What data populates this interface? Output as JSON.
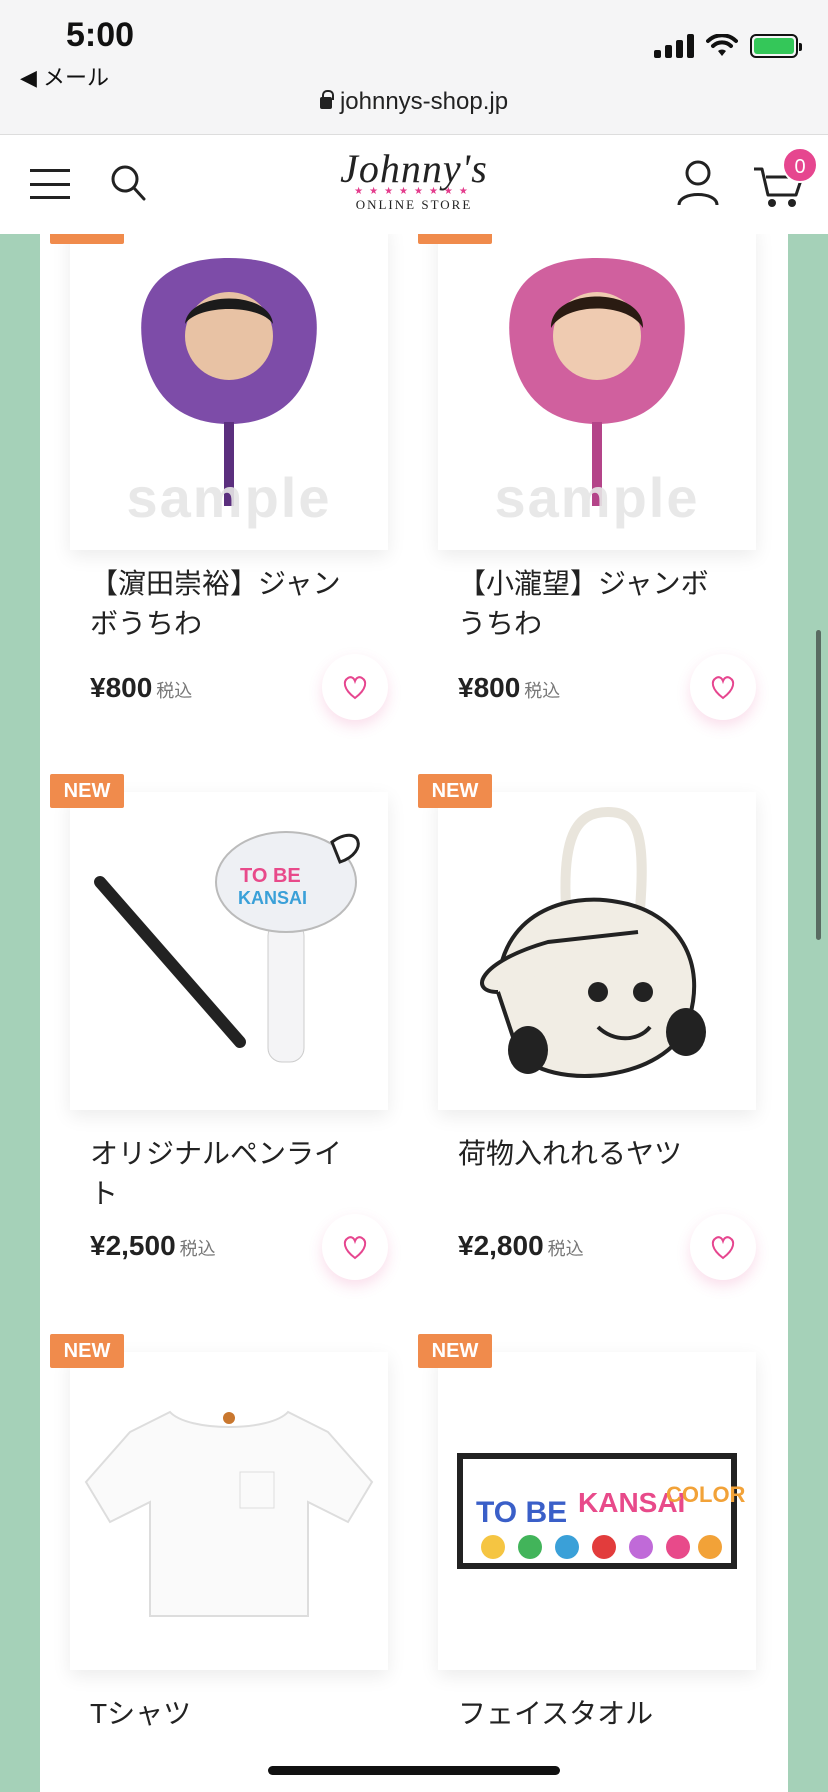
{
  "status_bar": {
    "time": "5:00",
    "back_label": "◀ メール",
    "url": "johnnys-shop.jp",
    "battery_color": "#34c759"
  },
  "header": {
    "logo_main": "Johnny's",
    "logo_sub": "ONLINE STORE",
    "cart_count": "0",
    "icons": [
      "menu-icon",
      "search-icon",
      "account-icon",
      "cart-icon"
    ]
  },
  "products": [
    {
      "name": "【濵田崇裕】ジャンボうちわ",
      "price": "¥800",
      "tax": "税込",
      "badge": "NEW",
      "image": "uchiwa-purple"
    },
    {
      "name": "【小瀧望】ジャンボうちわ",
      "price": "¥800",
      "tax": "税込",
      "badge": "NEW",
      "image": "uchiwa-pink"
    },
    {
      "name": "オリジナルペンライト",
      "price": "¥2,500",
      "tax": "税込",
      "badge": "NEW",
      "image": "penlight"
    },
    {
      "name": "荷物入れれるヤツ",
      "price": "¥2,800",
      "tax": "税込",
      "badge": "NEW",
      "image": "tote-bag"
    },
    {
      "name": "Tシャツ",
      "price": "",
      "tax": "",
      "badge": "NEW",
      "image": "t-shirt"
    },
    {
      "name": "フェイスタオル",
      "price": "",
      "tax": "",
      "badge": "NEW",
      "image": "face-towel"
    }
  ],
  "sample_watermark": "sample",
  "colors": {
    "accent_pink": "#e6468f",
    "badge_orange": "#f08b4c",
    "side_green": "#a5d1b8"
  }
}
